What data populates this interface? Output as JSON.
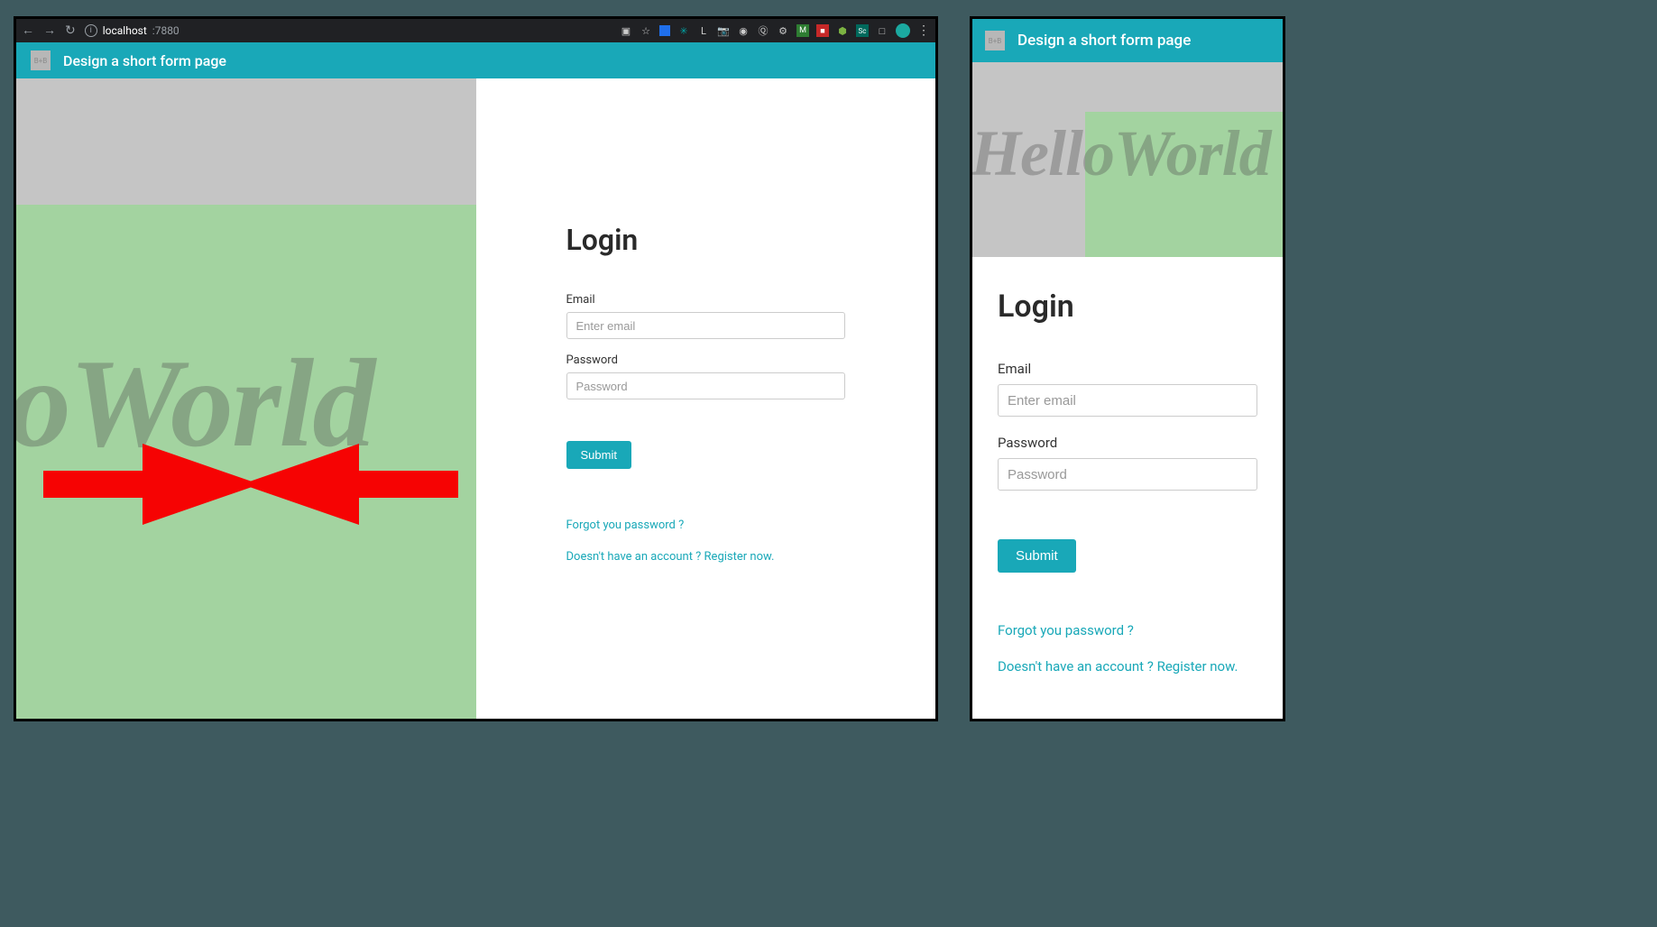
{
  "browser": {
    "url_host": "localhost",
    "url_port": ":7880"
  },
  "header": {
    "logo_text": "B+B",
    "title": "Design a short form page"
  },
  "hero": {
    "text": "HelloWorld",
    "text_partial": "oWorld"
  },
  "form": {
    "title": "Login",
    "email_label": "Email",
    "email_placeholder": "Enter email",
    "password_label": "Password",
    "password_placeholder": "Password",
    "submit_label": "Submit",
    "forgot_link": "Forgot you password ?",
    "register_link": "Doesn't have an account ? Register now."
  },
  "colors": {
    "accent": "#19a8b8",
    "arrow": "#F60303",
    "green": "#a3d3a0",
    "grey": "#c5c5c5"
  }
}
